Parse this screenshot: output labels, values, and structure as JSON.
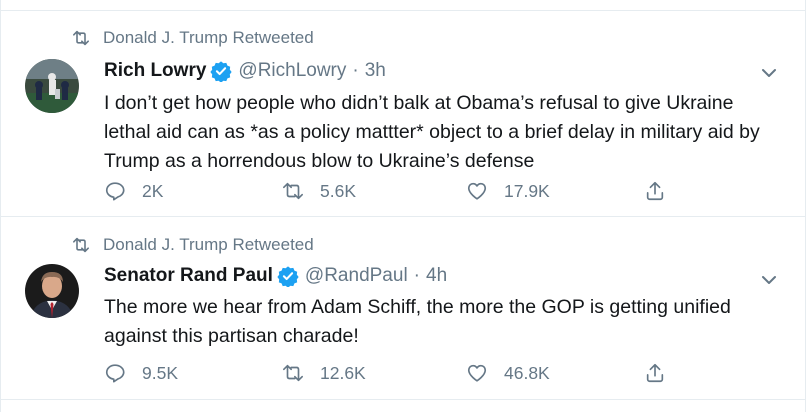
{
  "tweets": [
    {
      "retweet_label": "Donald J. Trump Retweeted",
      "display_name": "Rich Lowry",
      "handle": "@RichLowry",
      "separator": "·",
      "time": "3h",
      "text": "I don’t get how people who didn’t balk at Obama’s refusal to give Ukraine lethal aid can as *as a policy mattter* object to a brief delay in military aid by Trump as a horrendous blow to Ukraine’s defense",
      "replies": "2K",
      "retweets": "5.6K",
      "likes": "17.9K"
    },
    {
      "retweet_label": "Donald J. Trump Retweeted",
      "display_name": "Senator Rand Paul",
      "handle": "@RandPaul",
      "separator": "·",
      "time": "4h",
      "text": "The more we hear from Adam Schiff, the more the GOP is getting unified against this partisan charade!",
      "replies": "9.5K",
      "retweets": "12.6K",
      "likes": "46.8K"
    }
  ],
  "colors": {
    "text": "#14171a",
    "secondary": "#657786",
    "verified": "#1da1f2",
    "border": "#e6ecf0"
  },
  "icons": [
    "retweet-icon",
    "verified-badge-icon",
    "chevron-down-icon",
    "reply-icon",
    "like-icon",
    "share-icon"
  ]
}
